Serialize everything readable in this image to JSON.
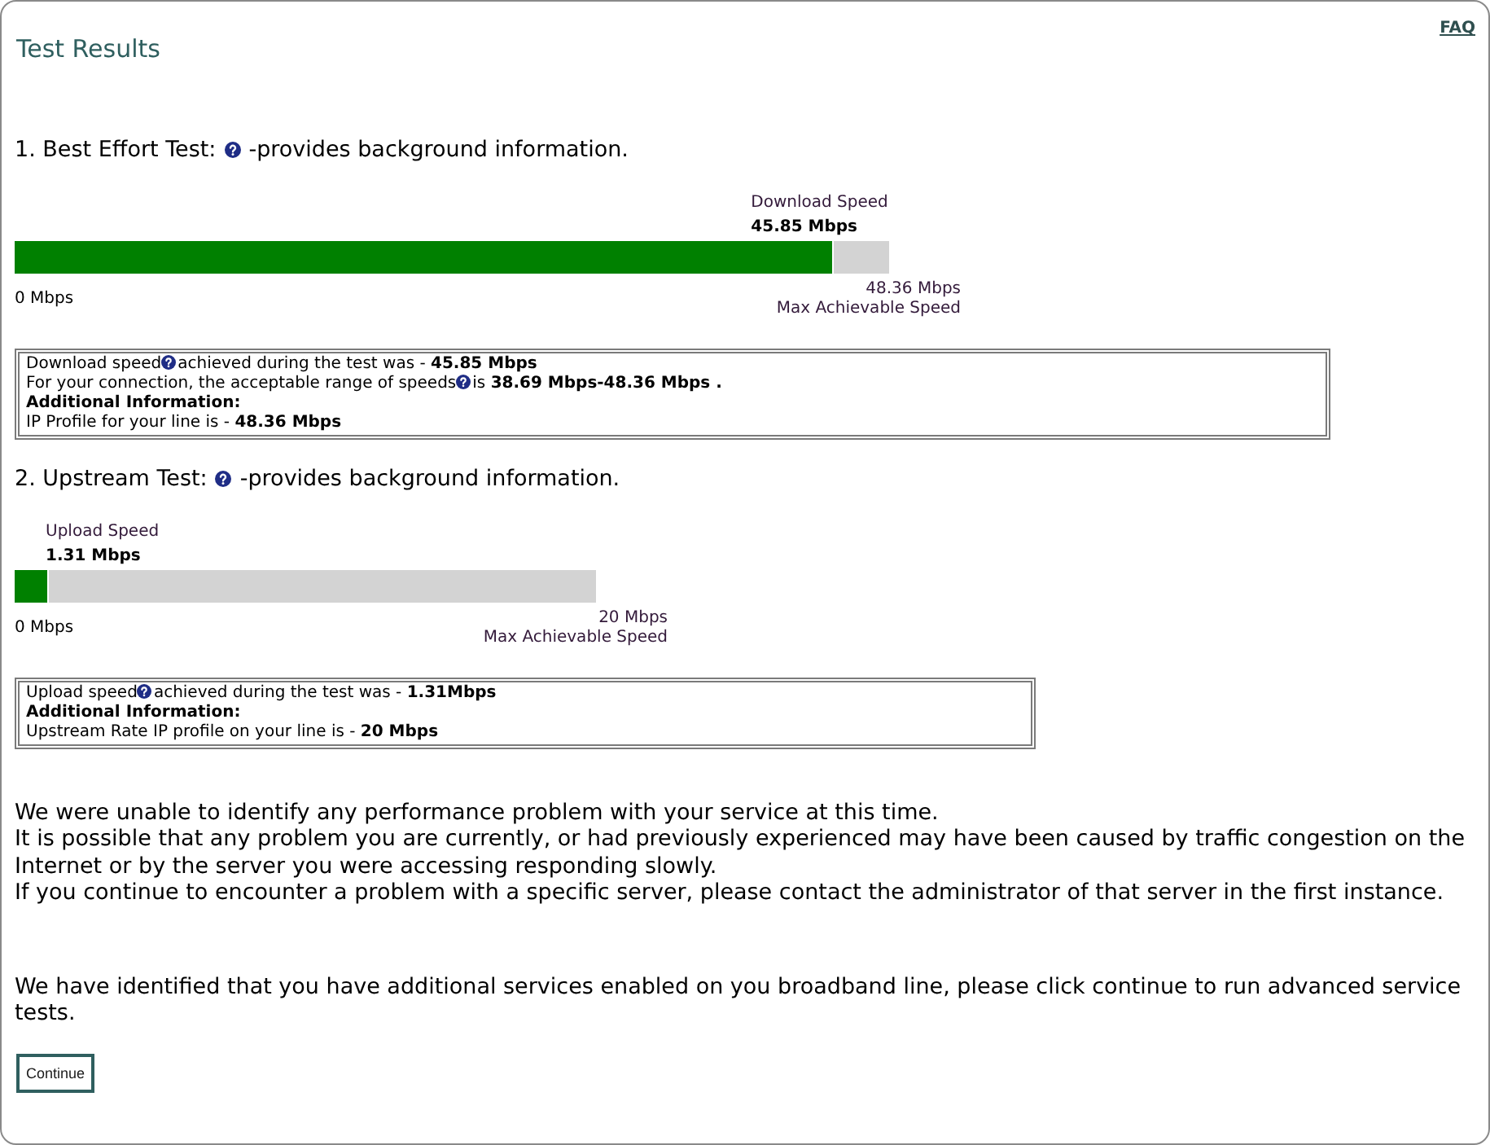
{
  "header": {
    "title": "Test Results",
    "faq_link": "FAQ"
  },
  "tests": [
    {
      "heading": "1. Best Effort Test:",
      "help_note": "-provides background information.",
      "meter": {
        "label": "Download Speed",
        "value": "45.85 Mbps",
        "level": 0.937,
        "min_label": "0 Mbps",
        "max_value": "48.36 Mbps",
        "max_label": "Max Achievable Speed"
      },
      "info_box": {
        "lines": [
          {
            "kind": "help",
            "parts": [
              "Download speed",
              "achieved during the test was - **45.85 Mbps**"
            ]
          },
          {
            "kind": "help",
            "parts": [
              "For your connection, the acceptable range of speeds",
              "is **38.69 Mbps-48.36 Mbps .**"
            ]
          },
          {
            "kind": "heading",
            "parts": [
              "Additional Information:"
            ]
          },
          {
            "kind": "plain",
            "parts": [
              "IP Profile for your line is - **48.36 Mbps**"
            ]
          }
        ]
      }
    },
    {
      "heading": "2. Upstream Test:",
      "help_note": "-provides background information.",
      "meter": {
        "label": "Upload Speed",
        "value": "1.31 Mbps",
        "level": 0.06,
        "min_label": "0 Mbps",
        "max_value": "20 Mbps",
        "max_label": "Max Achievable Speed"
      },
      "info_box": {
        "lines": [
          {
            "kind": "help",
            "parts": [
              "Upload speed",
              "achieved during the test was - **1.31Mbps**"
            ]
          },
          {
            "kind": "heading",
            "parts": [
              "Additional Information:"
            ]
          },
          {
            "kind": "plain",
            "parts": [
              "Upstream Rate IP profile on your line is - **20 Mbps**"
            ]
          }
        ]
      }
    }
  ],
  "notices": [
    {
      "lines": [
        "We were unable to identify any performance problem with your service at this time.",
        "It is possible that any problem you are currently, or had previously experienced may have been caused by traffic congestion on the Internet or by the server you were accessing responding slowly.",
        "If you continue to encounter a problem with a specific server, please contact the administrator of that server in the first instance."
      ]
    },
    {
      "lines": [
        "We have identified that you have additional services enabled on you broadband line, please click continue to run advanced service tests."
      ]
    }
  ],
  "continue_button": "Continue"
}
